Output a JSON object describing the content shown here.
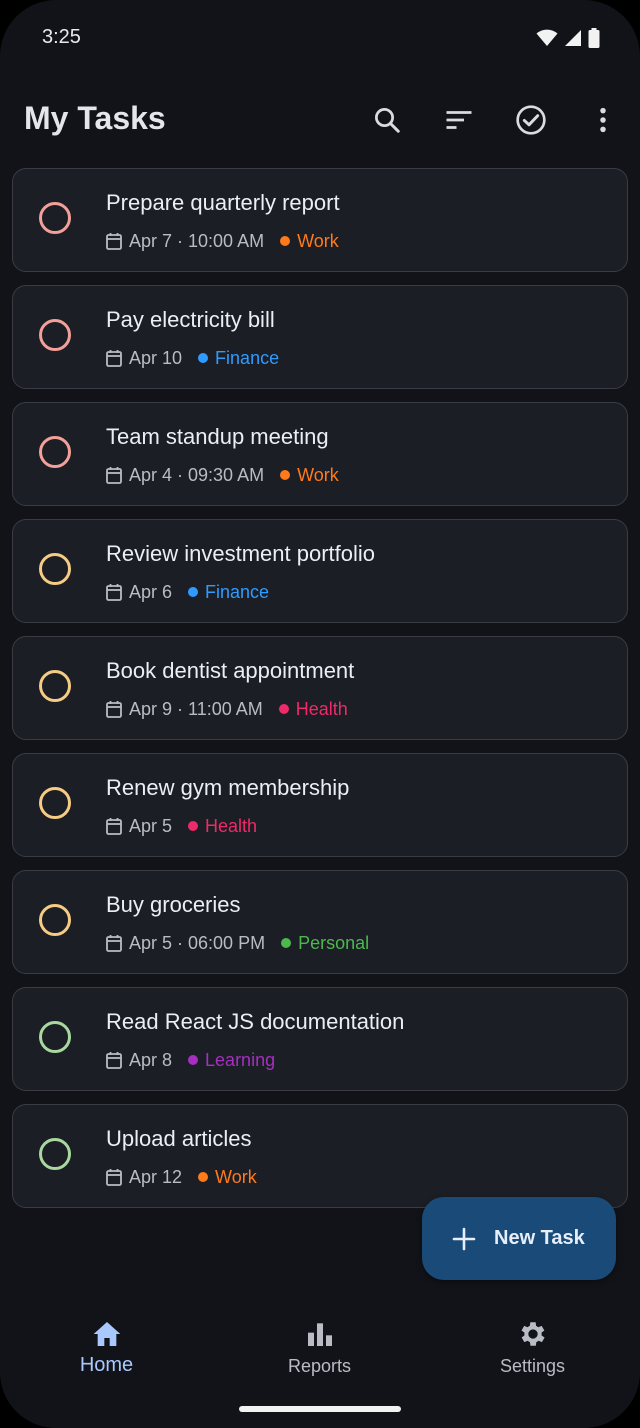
{
  "status_bar": {
    "time": "3:25"
  },
  "app_bar": {
    "title": "My Tasks",
    "actions": [
      "search-icon",
      "sort-icon",
      "check-circle-icon",
      "more-vert-icon"
    ]
  },
  "colors": {
    "background": "#111318",
    "card": "#1b1e24",
    "card_border": "#393c44",
    "priority_high": "#f2a099",
    "priority_medium": "#f6cc84",
    "priority_low": "#a8d8a0",
    "work": "#ff7a1a",
    "finance": "#2f9bff",
    "health": "#ef2a6a",
    "personal": "#4cb84e",
    "learning": "#a62ec0",
    "accent": "#a9c8ff",
    "fab": "#1a4b78"
  },
  "tasks": [
    {
      "title": "Prepare quarterly report",
      "date": "Apr 7 · 10:00 AM",
      "category": "Work",
      "category_color": "#ff7a1a",
      "priority_color": "#f2a099"
    },
    {
      "title": "Pay electricity bill",
      "date": "Apr 10",
      "category": "Finance",
      "category_color": "#2f9bff",
      "priority_color": "#f2a099"
    },
    {
      "title": "Team standup meeting",
      "date": "Apr 4 · 09:30 AM",
      "category": "Work",
      "category_color": "#ff7a1a",
      "priority_color": "#f2a099"
    },
    {
      "title": "Review investment portfolio",
      "date": "Apr 6",
      "category": "Finance",
      "category_color": "#2f9bff",
      "priority_color": "#f6cc84"
    },
    {
      "title": "Book dentist appointment",
      "date": "Apr 9 · 11:00 AM",
      "category": "Health",
      "category_color": "#ef2a6a",
      "priority_color": "#f6cc84"
    },
    {
      "title": "Renew gym membership",
      "date": "Apr 5",
      "category": "Health",
      "category_color": "#ef2a6a",
      "priority_color": "#f6cc84"
    },
    {
      "title": "Buy groceries",
      "date": "Apr 5 · 06:00 PM",
      "category": "Personal",
      "category_color": "#4cb84e",
      "priority_color": "#f6cc84"
    },
    {
      "title": "Read React JS documentation",
      "date": "Apr 8",
      "category": "Learning",
      "category_color": "#a62ec0",
      "priority_color": "#a8d8a0"
    },
    {
      "title": "Upload articles",
      "date": "Apr 12",
      "category": "Work",
      "category_color": "#ff7a1a",
      "priority_color": "#a8d8a0"
    }
  ],
  "fab": {
    "label": "New Task",
    "icon": "plus-icon"
  },
  "bottom_nav": {
    "items": [
      {
        "label": "Home",
        "icon": "home-icon",
        "active": true
      },
      {
        "label": "Reports",
        "icon": "bar-chart-icon",
        "active": false
      },
      {
        "label": "Settings",
        "icon": "gear-icon",
        "active": false
      }
    ]
  }
}
